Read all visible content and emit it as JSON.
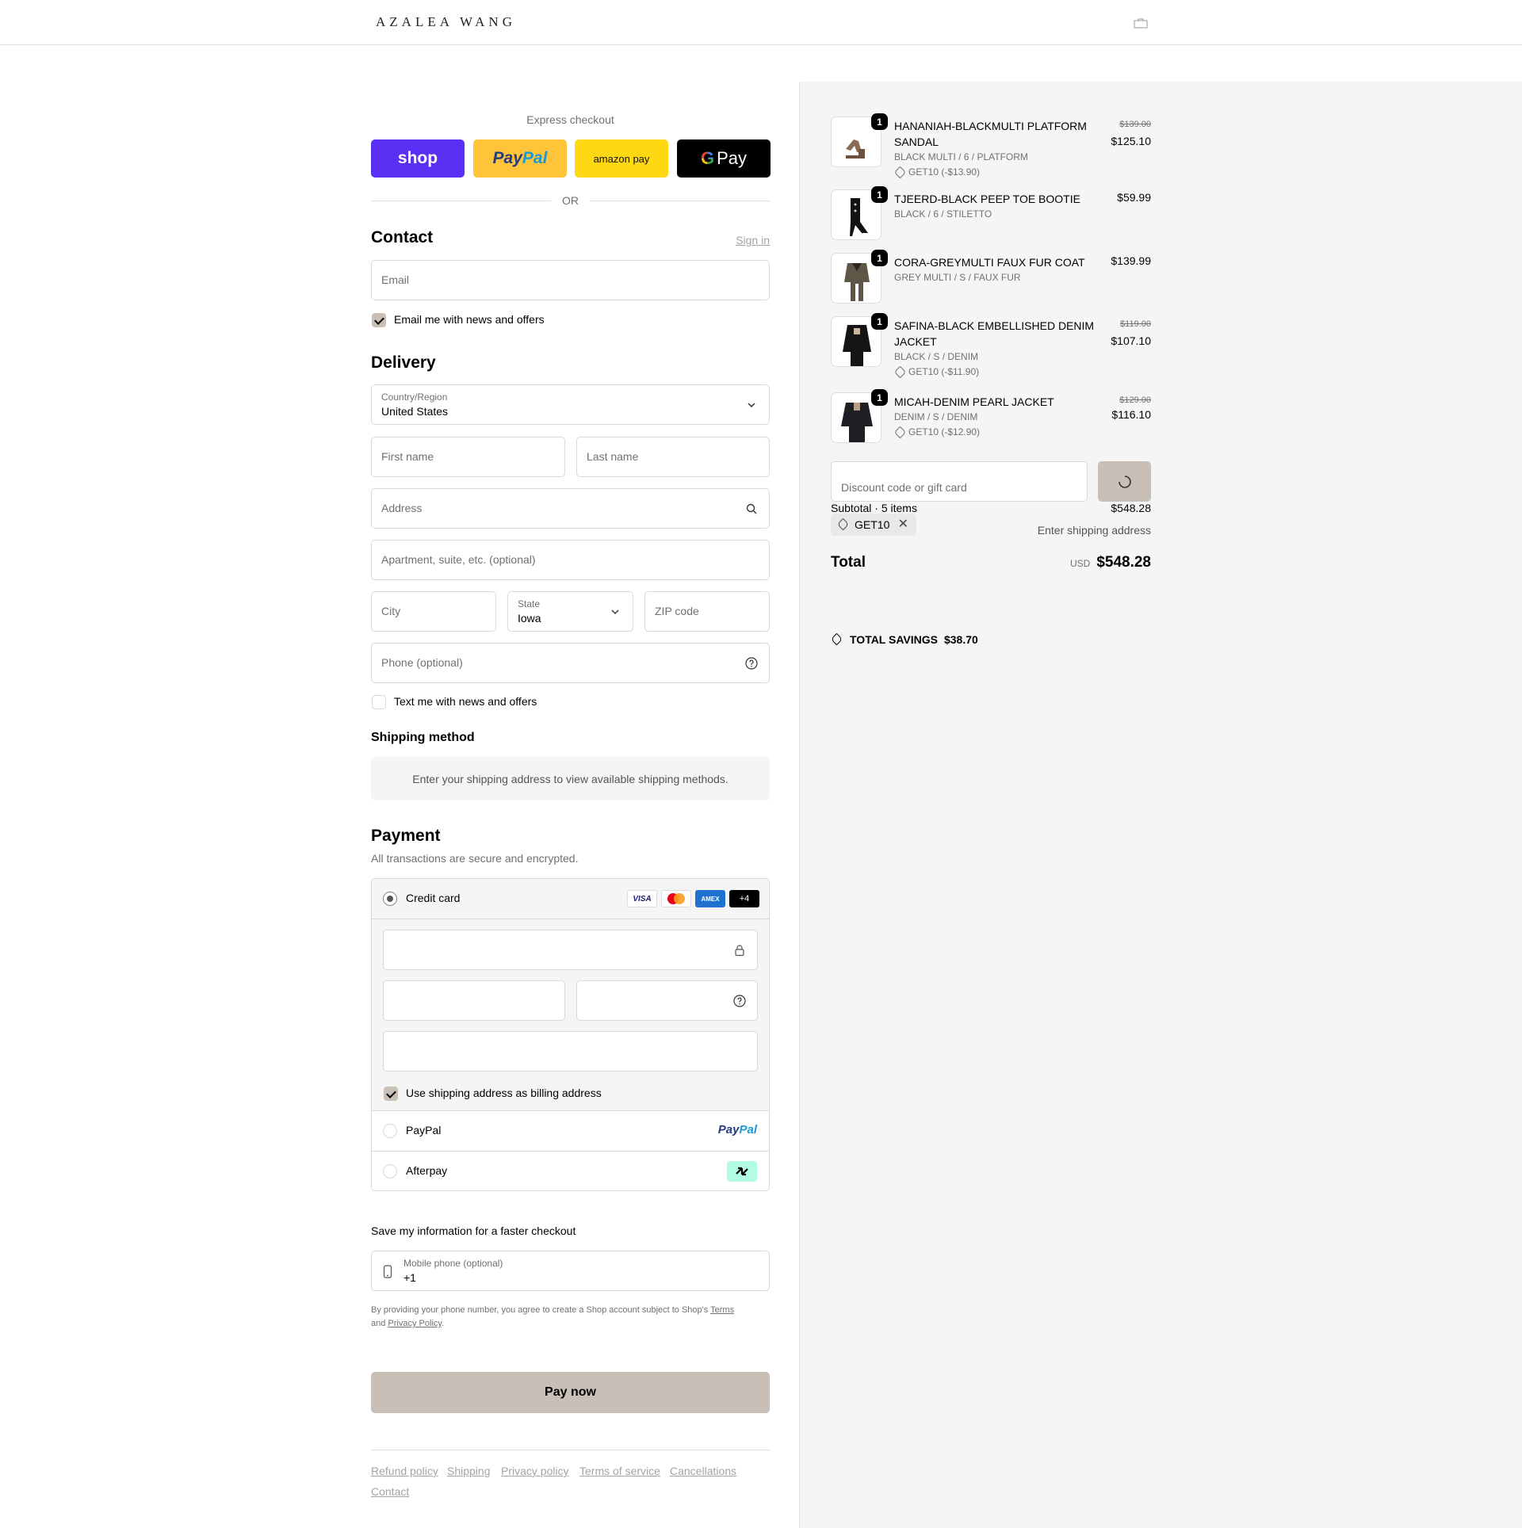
{
  "brand": "AZALEA WANG",
  "express": {
    "title": "Express checkout",
    "buttons": {
      "shop": "shop",
      "paypal_a": "Pay",
      "paypal_b": "Pal",
      "amazon": "amazon pay",
      "gpay_g": "G",
      "gpay": "Pay"
    },
    "or": "OR"
  },
  "contact": {
    "heading": "Contact",
    "sign_in": "Sign in",
    "email_placeholder": "Email",
    "news_label": "Email me with news and offers"
  },
  "delivery": {
    "heading": "Delivery",
    "country_label": "Country/Region",
    "country_value": "United States",
    "first_name": "First name",
    "last_name": "Last name",
    "address": "Address",
    "apartment": "Apartment, suite, etc. (optional)",
    "city": "City",
    "state_label": "State",
    "state_value": "Iowa",
    "zip": "ZIP code",
    "phone": "Phone (optional)",
    "text_label": "Text me with news and offers"
  },
  "shipping": {
    "heading": "Shipping method",
    "message": "Enter your shipping address to view available shipping methods."
  },
  "payment": {
    "heading": "Payment",
    "subtitle": "All transactions are secure and encrypted.",
    "credit_card": "Credit card",
    "card_logos": {
      "visa": "VISA",
      "amex": "AMEX",
      "more": "+4"
    },
    "billing_label": "Use shipping address as billing address",
    "paypal": "PayPal",
    "paypal_logo_a": "Pay",
    "paypal_logo_b": "Pal",
    "afterpay": "Afterpay"
  },
  "save_info": {
    "heading": "Save my information for a faster checkout",
    "mobile_label": "Mobile phone (optional)",
    "mobile_value": "+1",
    "legal_prefix": "By providing your phone number, you agree to create a Shop account subject to Shop's ",
    "terms": "Terms",
    "legal_and": "and ",
    "privacy": "Privacy Policy",
    "legal_end": "."
  },
  "pay_now": "Pay now",
  "footer_links": [
    "Refund policy",
    "Shipping",
    "Privacy policy",
    "Terms of service",
    "Cancellations",
    "Contact"
  ],
  "cart": {
    "items": [
      {
        "qty": "1",
        "name": "HANANIAH-BLACKMULTI PLATFORM SANDAL",
        "variant": "BLACK MULTI / 6 / PLATFORM",
        "discount": "GET10 (-$13.90)",
        "old_price": "$139.00",
        "price": "$125.10"
      },
      {
        "qty": "1",
        "name": "TJEERD-BLACK PEEP TOE BOOTIE",
        "variant": "BLACK / 6 / STILETTO",
        "discount": "",
        "old_price": "",
        "price": "$59.99"
      },
      {
        "qty": "1",
        "name": "CORA-GREYMULTI FAUX FUR COAT",
        "variant": "GREY MULTI / S / FAUX FUR",
        "discount": "",
        "old_price": "",
        "price": "$139.99"
      },
      {
        "qty": "1",
        "name": "SAFINA-BLACK EMBELLISHED DENIM JACKET",
        "variant": "BLACK / S / DENIM",
        "discount": "GET10 (-$11.90)",
        "old_price": "$119.00",
        "price": "$107.10"
      },
      {
        "qty": "1",
        "name": "MICAH-DENIM PEARL JACKET",
        "variant": "DENIM / S / DENIM",
        "discount": "GET10 (-$12.90)",
        "old_price": "$129.00",
        "price": "$116.10"
      }
    ],
    "discount_placeholder": "Discount code or gift card",
    "subtotal_label": "Subtotal · 5 items",
    "subtotal_value": "$548.28",
    "applied_code": "GET10",
    "shipping_note": "Enter shipping address",
    "total_label": "Total",
    "currency": "USD",
    "total_value": "$548.28",
    "savings_label": "TOTAL SAVINGS",
    "savings_value": "$38.70"
  }
}
